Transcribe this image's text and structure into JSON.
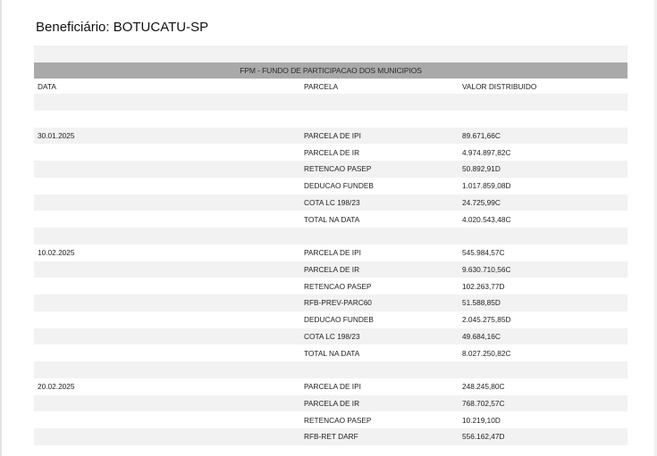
{
  "page_title": "Beneficiário: BOTUCATU-SP",
  "report": {
    "title": "FPM   - FUNDO DE PARTICIPACAO DOS MUNICIPIOS",
    "headers": {
      "date": "DATA",
      "parcel": "PARCELA",
      "value": "VALOR DISTRIBUIDO"
    },
    "rows": [
      {
        "date": "",
        "parcel": "",
        "value": ""
      },
      {
        "date": "",
        "parcel": "",
        "value": ""
      },
      {
        "date": "30.01.2025",
        "parcel": "PARCELA DE IPI",
        "value": "89.671,66C"
      },
      {
        "date": "",
        "parcel": "PARCELA DE IR",
        "value": "4.974.897,82C"
      },
      {
        "date": "",
        "parcel": "RETENCAO PASEP",
        "value": "50.892,91D"
      },
      {
        "date": "",
        "parcel": "DEDUCAO FUNDEB",
        "value": "1.017.859,08D"
      },
      {
        "date": "",
        "parcel": "COTA LC 198/23",
        "value": "24.725,99C"
      },
      {
        "date": "",
        "parcel": "TOTAL NA DATA",
        "value": "4.020.543,48C"
      },
      {
        "date": "",
        "parcel": "",
        "value": ""
      },
      {
        "date": "10.02.2025",
        "parcel": "PARCELA DE IPI",
        "value": "545.984,57C"
      },
      {
        "date": "",
        "parcel": "PARCELA DE IR",
        "value": "9.630.710,56C"
      },
      {
        "date": "",
        "parcel": "RETENCAO PASEP",
        "value": "102.263,77D"
      },
      {
        "date": "",
        "parcel": "RFB-PREV-PARC60",
        "value": "51.588,85D"
      },
      {
        "date": "",
        "parcel": "DEDUCAO FUNDEB",
        "value": "2.045.275,85D"
      },
      {
        "date": "",
        "parcel": "COTA LC 198/23",
        "value": "49.684,16C"
      },
      {
        "date": "",
        "parcel": "TOTAL NA DATA",
        "value": "8.027.250,82C"
      },
      {
        "date": "",
        "parcel": "",
        "value": ""
      },
      {
        "date": "20.02.2025",
        "parcel": "PARCELA DE IPI",
        "value": "248.245,80C"
      },
      {
        "date": "",
        "parcel": "PARCELA DE IR",
        "value": "768.702,57C"
      },
      {
        "date": "",
        "parcel": "RETENCAO PASEP",
        "value": "10.219,10D"
      },
      {
        "date": "",
        "parcel": "RFB-RET DARF",
        "value": "556.162,47D"
      }
    ]
  }
}
